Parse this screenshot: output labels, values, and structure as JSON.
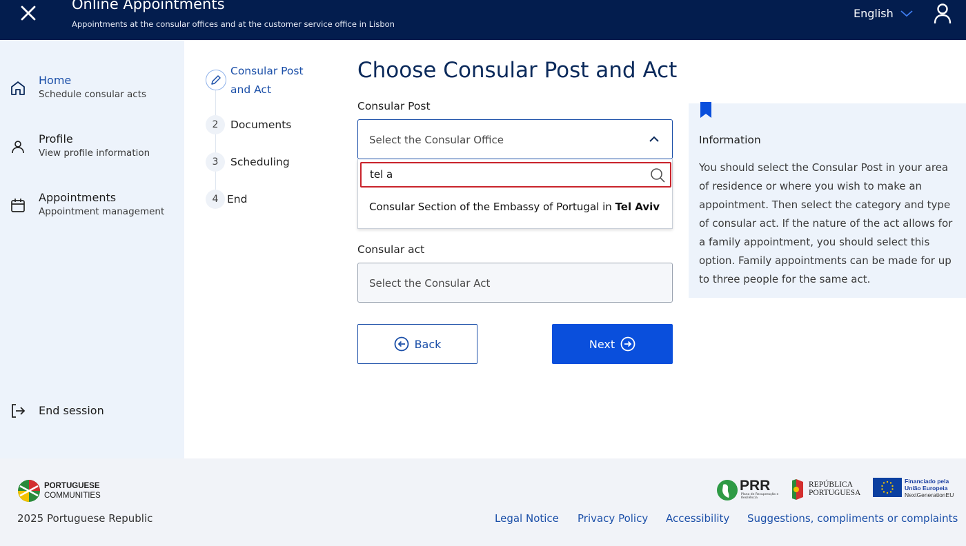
{
  "header": {
    "title": "Online Appointments",
    "subtitle": "Appointments at the consular offices and at the customer service office in Lisbon",
    "language": "English"
  },
  "sidebar": {
    "items": [
      {
        "label": "Home",
        "sub": "Schedule consular acts",
        "icon": "home-icon"
      },
      {
        "label": "Profile",
        "sub": "View profile information",
        "icon": "person-icon"
      },
      {
        "label": "Appointments",
        "sub": "Appointment management",
        "icon": "calendar-icon"
      }
    ],
    "end_session": "End session"
  },
  "stepper": {
    "steps": [
      {
        "number": "",
        "label": "Consular Post",
        "label2": "and Act",
        "active": true
      },
      {
        "number": "2",
        "label": "Documents"
      },
      {
        "number": "3",
        "label": "Scheduling"
      },
      {
        "number": "4",
        "label": "End"
      }
    ]
  },
  "main": {
    "title": "Choose Consular Post and Act",
    "consular_post_label": "Consular Post",
    "consular_post_placeholder": "Select the Consular Office",
    "search_value": "tel a",
    "option_prefix": "Consular Section of the Embassy of Portugal in ",
    "option_match": "Tel Aviv",
    "consular_act_label": "Consular act",
    "consular_act_placeholder": "Select the Consular Act",
    "back_label": "Back",
    "next_label": "Next"
  },
  "info": {
    "title": "Information",
    "text": "You should select the Consular Post in your area of residence or where you wish to make an appointment. Then select the category and type of consular act. If the nature of the act allows for a family appointment, you should select this option. Family appointments can be made for up to three people for the same act."
  },
  "footer": {
    "brand_line1": "PORTUGUESE",
    "brand_line2": "COMMUNITIES",
    "copyright": "2025 Portuguese Republic",
    "links": [
      "Legal Notice",
      "Privacy Policy",
      "Accessibility",
      "Suggestions, compliments or complaints"
    ],
    "prr": "PRR",
    "prr_small": "Plano de Recuperação e Resiliência",
    "rp_line1": "REPÚBLICA",
    "rp_line2": "PORTUGUESA",
    "eu_line1": "Financiado pela",
    "eu_line2": "União Europeia",
    "eu_line3": "NextGenerationEU"
  },
  "colors": {
    "header_bg": "#031d4e",
    "primary": "#0a4fdc",
    "sidebar_bg": "#edf3fb",
    "search_border": "#c9232b"
  }
}
